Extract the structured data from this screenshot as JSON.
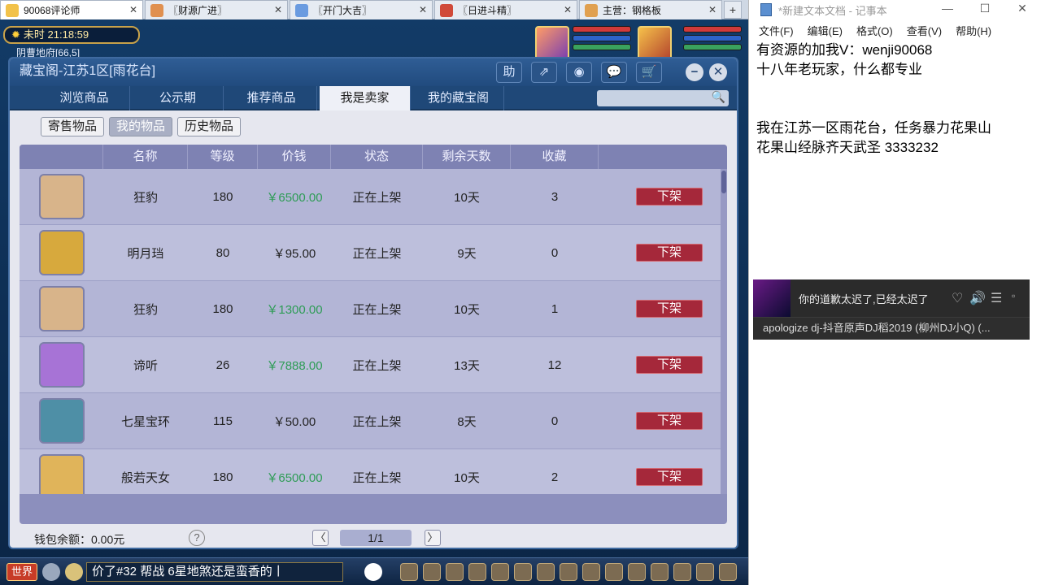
{
  "browser_tabs": [
    {
      "label": "90068评论师",
      "color": "#f2c24a",
      "active": true
    },
    {
      "label": "〖财源广进〗",
      "color": "#e09050",
      "active": false
    },
    {
      "label": "〖开门大吉〗",
      "color": "#6a9be0",
      "active": false
    },
    {
      "label": "〖日进斗精〗",
      "color": "#d04a3a",
      "active": false
    },
    {
      "label": "主营：钢格板",
      "color": "#e0a050",
      "active": false
    }
  ],
  "browser": {
    "close_glyph": "✕",
    "new_tab_glyph": "+"
  },
  "game_hud": {
    "sun_glyph": "✹",
    "clock": "未时  21:18:59",
    "location": "阴曹地府[66,5]"
  },
  "window": {
    "title": "藏宝阁-江苏1区[雨花台]",
    "title_buttons": {
      "help": "助",
      "share": "⇗",
      "record": "◉",
      "chat": "💬",
      "cart": "🛒",
      "minimize": "−",
      "close": "✕"
    },
    "nav_tabs": [
      "浏览商品",
      "公示期",
      "推荐商品",
      "我是卖家",
      "我的藏宝阁"
    ],
    "active_nav_tab": "我是卖家",
    "search": {
      "placeholder": "",
      "icon": "🔍"
    },
    "sub_tabs": [
      "寄售物品",
      "我的物品",
      "历史物品"
    ],
    "active_sub_tab": "我的物品",
    "columns": [
      "",
      "名称",
      "等级",
      "价钱",
      "状态",
      "剩余天数",
      "收藏",
      ""
    ],
    "rows": [
      {
        "name": "狂豹",
        "level": "180",
        "price": "￥6500.00",
        "price_green": true,
        "status": "正在上架",
        "days": "10天",
        "fav": "3",
        "action": "下架",
        "icon_color": "#d8b48a"
      },
      {
        "name": "明月珰",
        "level": "80",
        "price": "￥95.00",
        "price_green": false,
        "status": "正在上架",
        "days": "9天",
        "fav": "0",
        "action": "下架",
        "icon_color": "#d7a93d"
      },
      {
        "name": "狂豹",
        "level": "180",
        "price": "￥1300.00",
        "price_green": true,
        "status": "正在上架",
        "days": "10天",
        "fav": "1",
        "action": "下架",
        "icon_color": "#d8b48a"
      },
      {
        "name": "谛听",
        "level": "26",
        "price": "￥7888.00",
        "price_green": true,
        "status": "正在上架",
        "days": "13天",
        "fav": "12",
        "action": "下架",
        "icon_color": "#a773d6"
      },
      {
        "name": "七星宝环",
        "level": "115",
        "price": "￥50.00",
        "price_green": false,
        "status": "正在上架",
        "days": "8天",
        "fav": "0",
        "action": "下架",
        "icon_color": "#4e8fa6"
      },
      {
        "name": "般若天女",
        "level": "180",
        "price": "￥6500.00",
        "price_green": true,
        "status": "正在上架",
        "days": "10天",
        "fav": "2",
        "action": "下架",
        "icon_color": "#e0b45a"
      }
    ],
    "wallet": "钱包余额：0.00元",
    "help_glyph": "?",
    "page": "1/1",
    "prev_glyph": "〈",
    "next_glyph": "〉"
  },
  "chat": {
    "world": "世界",
    "message": "价了#32  帮战 6星地煞还是蛮香的丨"
  },
  "notepad": {
    "title": "*新建文本文档 - 记事本",
    "controls": {
      "minimize": "—",
      "maximize": "☐",
      "close": "✕"
    },
    "menu": [
      "文件(F)",
      "编辑(E)",
      "格式(O)",
      "查看(V)",
      "帮助(H)"
    ],
    "lines": [
      "有资源的加我V：wenji90068",
      "十八年老玩家，什么都专业",
      "",
      "我在江苏一区雨花台，任务暴力花果山",
      "花果山经脉齐天武圣 3333232"
    ]
  },
  "music": {
    "lyric": "你的道歉太迟了,已经太迟了",
    "track": "apologize dj-抖音原声DJ稻2019 (柳州DJ小Q) (...",
    "controls": {
      "like": "♡",
      "volume": "🔊",
      "list": "☰",
      "more": "▫"
    }
  }
}
